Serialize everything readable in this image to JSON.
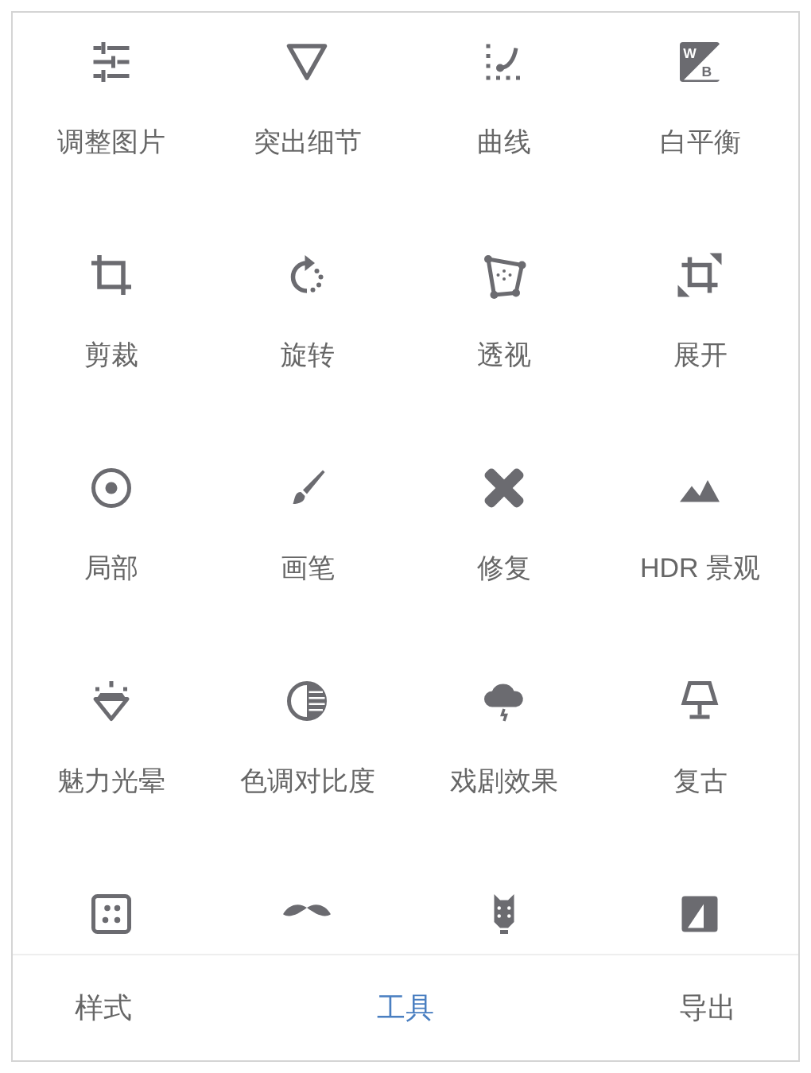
{
  "tools": [
    {
      "kind": "full",
      "label": "调整图片"
    },
    {
      "kind": "full",
      "label": "突出细节"
    },
    {
      "kind": "full",
      "label": "曲线"
    },
    {
      "kind": "full",
      "label": "白平衡"
    },
    {
      "kind": "full",
      "label": "剪裁"
    },
    {
      "kind": "full",
      "label": "旋转"
    },
    {
      "kind": "full",
      "label": "透视"
    },
    {
      "kind": "full",
      "label": "展开"
    },
    {
      "kind": "full",
      "label": "局部"
    },
    {
      "kind": "full",
      "label": "画笔"
    },
    {
      "kind": "full",
      "label": "修复"
    },
    {
      "kind": "full",
      "label": "HDR 景观"
    },
    {
      "kind": "full",
      "label": "魅力光晕"
    },
    {
      "kind": "full",
      "label": "色调对比度"
    },
    {
      "kind": "full",
      "label": "戏剧效果"
    },
    {
      "kind": "full",
      "label": "复古"
    },
    {
      "kind": "cut"
    },
    {
      "kind": "cut"
    },
    {
      "kind": "cut"
    },
    {
      "kind": "cut"
    }
  ],
  "wb_icon_letters": [
    "W",
    "B"
  ],
  "tabs": [
    {
      "label": "样式",
      "selected": false
    },
    {
      "label": "工具",
      "selected": true
    },
    {
      "label": "导出",
      "selected": false
    }
  ]
}
